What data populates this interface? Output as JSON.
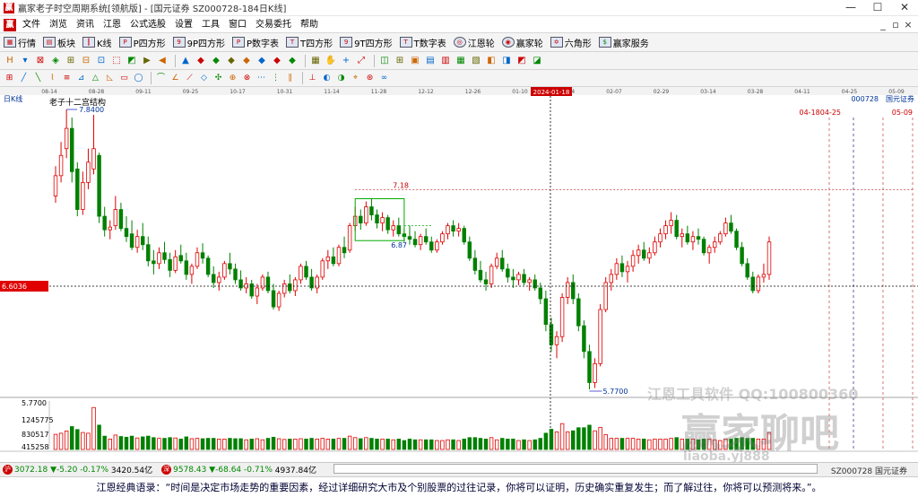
{
  "window": {
    "title": "赢家老子时空周期系统[领航版] - [国元证券 SZ000728-184日K线]",
    "controls": [
      "—",
      "☐",
      "✕"
    ]
  },
  "menu": {
    "items": [
      "文件",
      "浏览",
      "资讯",
      "江恩",
      "公式选股",
      "设置",
      "工具",
      "窗口",
      "交易委托",
      "帮助"
    ],
    "mdi_controls": [
      "_",
      "▫",
      "×"
    ]
  },
  "toolbar1": {
    "items": [
      "行情",
      "板块",
      "K线",
      "P四方形",
      "9P四方形",
      "P数字表",
      "T四方形",
      "9T四方形",
      "T数字表",
      "江恩轮",
      "赢家轮",
      "六角形",
      "赢家服务"
    ]
  },
  "chart": {
    "panel_label": "日K线",
    "indicator_name": "老子十二宫结构",
    "stock_code": "000728",
    "stock_name": "国元证券",
    "cursor_date": "2024-01-18",
    "top_dates": [
      "08-14",
      "08-28",
      "09-11",
      "09-25",
      "10-17",
      "10-31",
      "11-14",
      "11-28",
      "12-12",
      "12-26",
      "01-10",
      "01-24",
      "02-07",
      "02-29",
      "03-14",
      "03-28",
      "04-11",
      "04-25",
      "05-09"
    ],
    "future_dates": [
      "04-18",
      "04-25",
      "05-09"
    ],
    "price_labels": {
      "high": "7.8400",
      "level_718": "7.18",
      "level_687": "6.87",
      "low": "5.7700",
      "cursor_price": "6.6036"
    },
    "volume_labels": [
      "5.7700",
      "1245775",
      "830517",
      "415258"
    ],
    "watermark": {
      "line1": "江恩工具软件  QQ:100800360",
      "line2": "赢家聊吧",
      "line3": "liaoba.yj888"
    },
    "colors": {
      "up": "#e00000",
      "down": "#008000",
      "cursor": "#e00000",
      "date_blue": "#003399"
    }
  },
  "chart_data": {
    "type": "candlestick",
    "title": "国元证券 SZ000728-184日K线",
    "indicator": "老子十二宫结构",
    "ohlc_note": "approximate, read from chart",
    "ohlc": [
      [
        7.2,
        7.42,
        7.15,
        7.35
      ],
      [
        7.35,
        7.6,
        7.3,
        7.5
      ],
      [
        7.55,
        7.84,
        7.48,
        7.7
      ],
      [
        7.7,
        7.78,
        7.3,
        7.38
      ],
      [
        7.4,
        7.45,
        7.05,
        7.1
      ],
      [
        7.1,
        7.38,
        7.06,
        7.3
      ],
      [
        7.3,
        7.55,
        7.25,
        7.45
      ],
      [
        7.4,
        7.8,
        7.36,
        7.55
      ],
      [
        7.5,
        7.52,
        7.0,
        7.05
      ],
      [
        7.05,
        7.12,
        6.9,
        6.95
      ],
      [
        6.95,
        7.02,
        6.88,
        6.97
      ],
      [
        6.98,
        7.2,
        6.95,
        7.1
      ],
      [
        7.1,
        7.15,
        6.94,
        6.96
      ],
      [
        6.96,
        7.05,
        6.86,
        6.9
      ],
      [
        6.92,
        7.02,
        6.8,
        6.82
      ],
      [
        6.82,
        6.95,
        6.78,
        6.9
      ],
      [
        6.9,
        7.0,
        6.8,
        6.84
      ],
      [
        6.84,
        6.9,
        6.68,
        6.72
      ],
      [
        6.72,
        6.8,
        6.62,
        6.7
      ],
      [
        6.7,
        6.82,
        6.66,
        6.78
      ],
      [
        6.78,
        6.86,
        6.7,
        6.73
      ],
      [
        6.73,
        6.78,
        6.6,
        6.65
      ],
      [
        6.65,
        6.8,
        6.63,
        6.75
      ],
      [
        6.76,
        6.84,
        6.7,
        6.72
      ],
      [
        6.72,
        6.78,
        6.58,
        6.62
      ],
      [
        6.62,
        6.7,
        6.55,
        6.68
      ],
      [
        6.68,
        6.82,
        6.66,
        6.78
      ],
      [
        6.78,
        6.85,
        6.7,
        6.74
      ],
      [
        6.74,
        6.76,
        6.6,
        6.62
      ],
      [
        6.62,
        6.68,
        6.52,
        6.56
      ],
      [
        6.56,
        6.64,
        6.5,
        6.6
      ],
      [
        6.6,
        6.72,
        6.58,
        6.7
      ],
      [
        6.7,
        6.78,
        6.62,
        6.66
      ],
      [
        6.66,
        6.7,
        6.55,
        6.58
      ],
      [
        6.58,
        6.65,
        6.5,
        6.52
      ],
      [
        6.52,
        6.6,
        6.48,
        6.55
      ],
      [
        6.55,
        6.58,
        6.44,
        6.46
      ],
      [
        6.46,
        6.55,
        6.4,
        6.52
      ],
      [
        6.52,
        6.62,
        6.5,
        6.6
      ],
      [
        6.6,
        6.64,
        6.48,
        6.5
      ],
      [
        6.5,
        6.55,
        6.36,
        6.38
      ],
      [
        6.38,
        6.5,
        6.35,
        6.48
      ],
      [
        6.48,
        6.58,
        6.45,
        6.55
      ],
      [
        6.55,
        6.62,
        6.48,
        6.5
      ],
      [
        6.5,
        6.6,
        6.46,
        6.58
      ],
      [
        6.58,
        6.7,
        6.55,
        6.68
      ],
      [
        6.68,
        6.72,
        6.58,
        6.6
      ],
      [
        6.6,
        6.66,
        6.5,
        6.52
      ],
      [
        6.52,
        6.62,
        6.48,
        6.6
      ],
      [
        6.6,
        6.74,
        6.58,
        6.72
      ],
      [
        6.72,
        6.8,
        6.66,
        6.75
      ],
      [
        6.75,
        6.82,
        6.68,
        6.7
      ],
      [
        6.7,
        6.84,
        6.68,
        6.82
      ],
      [
        6.82,
        6.9,
        6.74,
        6.78
      ],
      [
        6.8,
        7.0,
        6.78,
        6.98
      ],
      [
        6.98,
        7.12,
        6.94,
        7.05
      ],
      [
        7.05,
        7.1,
        6.95,
        7.0
      ],
      [
        7.0,
        7.16,
        6.98,
        7.12
      ],
      [
        7.12,
        7.18,
        7.02,
        7.06
      ],
      [
        7.06,
        7.1,
        6.96,
        7.0
      ],
      [
        7.0,
        7.08,
        6.94,
        7.04
      ],
      [
        7.04,
        7.06,
        6.92,
        6.95
      ],
      [
        6.95,
        7.02,
        6.9,
        6.98
      ],
      [
        6.98,
        7.04,
        6.9,
        6.92
      ],
      [
        6.92,
        6.96,
        6.86,
        6.9
      ],
      [
        6.9,
        6.98,
        6.84,
        6.88
      ],
      [
        6.88,
        6.94,
        6.82,
        6.84
      ],
      [
        6.84,
        6.92,
        6.8,
        6.9
      ],
      [
        6.9,
        6.96,
        6.84,
        6.86
      ],
      [
        6.86,
        6.9,
        6.78,
        6.8
      ],
      [
        6.8,
        6.88,
        6.78,
        6.86
      ],
      [
        6.86,
        6.94,
        6.84,
        6.92
      ],
      [
        6.92,
        7.0,
        6.88,
        6.98
      ],
      [
        6.98,
        7.02,
        6.9,
        6.94
      ],
      [
        6.94,
        7.0,
        6.9,
        6.96
      ],
      [
        6.96,
        6.98,
        6.84,
        6.86
      ],
      [
        6.86,
        6.9,
        6.72,
        6.74
      ],
      [
        6.74,
        6.8,
        6.62,
        6.65
      ],
      [
        6.65,
        6.72,
        6.56,
        6.58
      ],
      [
        6.58,
        6.64,
        6.5,
        6.55
      ],
      [
        6.55,
        6.7,
        6.52,
        6.68
      ],
      [
        6.68,
        6.78,
        6.66,
        6.74
      ],
      [
        6.74,
        6.8,
        6.64,
        6.66
      ],
      [
        6.66,
        6.7,
        6.56,
        6.6
      ],
      [
        6.6,
        6.66,
        6.52,
        6.58
      ],
      [
        6.58,
        6.64,
        6.54,
        6.62
      ],
      [
        6.62,
        6.66,
        6.54,
        6.56
      ],
      [
        6.56,
        6.6,
        6.5,
        6.58
      ],
      [
        6.58,
        6.62,
        6.5,
        6.52
      ],
      [
        6.52,
        6.56,
        6.4,
        6.44
      ],
      [
        6.44,
        6.5,
        6.2,
        6.25
      ],
      [
        6.25,
        6.3,
        6.05,
        6.1
      ],
      [
        6.1,
        6.2,
        6.0,
        6.16
      ],
      [
        6.16,
        6.48,
        6.12,
        6.45
      ],
      [
        6.45,
        6.6,
        6.4,
        6.56
      ],
      [
        6.56,
        6.62,
        6.4,
        6.44
      ],
      [
        6.44,
        6.48,
        6.2,
        6.24
      ],
      [
        6.24,
        6.28,
        6.0,
        6.05
      ],
      [
        6.05,
        6.1,
        5.77,
        5.82
      ],
      [
        5.82,
        6.0,
        5.78,
        5.96
      ],
      [
        5.96,
        6.4,
        5.94,
        6.36
      ],
      [
        6.36,
        6.6,
        6.34,
        6.56
      ],
      [
        6.56,
        6.66,
        6.5,
        6.62
      ],
      [
        6.62,
        6.74,
        6.58,
        6.7
      ],
      [
        6.7,
        6.76,
        6.6,
        6.64
      ],
      [
        6.64,
        6.72,
        6.56,
        6.68
      ],
      [
        6.68,
        6.8,
        6.64,
        6.76
      ],
      [
        6.76,
        6.84,
        6.7,
        6.8
      ],
      [
        6.8,
        6.86,
        6.72,
        6.74
      ],
      [
        6.74,
        6.82,
        6.7,
        6.78
      ],
      [
        6.78,
        6.9,
        6.76,
        6.86
      ],
      [
        6.86,
        6.96,
        6.82,
        6.92
      ],
      [
        6.92,
        7.02,
        6.88,
        6.98
      ],
      [
        6.98,
        7.08,
        6.92,
        7.02
      ],
      [
        7.02,
        7.06,
        6.88,
        6.9
      ],
      [
        6.9,
        6.96,
        6.82,
        6.92
      ],
      [
        6.92,
        6.98,
        6.84,
        6.86
      ],
      [
        6.86,
        6.94,
        6.8,
        6.9
      ],
      [
        6.9,
        6.96,
        6.84,
        6.88
      ],
      [
        6.88,
        6.9,
        6.76,
        6.78
      ],
      [
        6.78,
        6.84,
        6.7,
        6.82
      ],
      [
        6.82,
        6.9,
        6.78,
        6.86
      ],
      [
        6.86,
        6.94,
        6.84,
        6.92
      ],
      [
        6.92,
        7.04,
        6.9,
        7.0
      ],
      [
        7.0,
        7.06,
        6.92,
        6.94
      ],
      [
        6.94,
        6.96,
        6.8,
        6.82
      ],
      [
        6.82,
        6.86,
        6.68,
        6.7
      ],
      [
        6.7,
        6.74,
        6.58,
        6.6
      ],
      [
        6.6,
        6.64,
        6.48,
        6.5
      ],
      [
        6.5,
        6.62,
        6.48,
        6.6
      ],
      [
        6.6,
        6.7,
        6.56,
        6.62
      ],
      [
        6.62,
        6.9,
        6.58,
        6.86
      ]
    ],
    "volume_ticks": [
      415258,
      830517,
      1245775
    ],
    "ylim": [
      5.77,
      7.84
    ],
    "x_ticks": [
      "08-14",
      "08-28",
      "09-11",
      "09-25",
      "10-17",
      "10-31",
      "11-14",
      "11-28",
      "12-12",
      "12-26",
      "01-10",
      "01-24",
      "02-07",
      "02-29",
      "03-14",
      "03-28",
      "04-11",
      "04-25",
      "05-09"
    ]
  },
  "status": {
    "sh_badge": "沪",
    "sh_value": "3072.18",
    "sh_change": "▼-5.20",
    "sh_pct": "-0.17%",
    "sh_amount": "3420.54亿",
    "sz_badge": "深",
    "sz_value": "9578.43",
    "sz_change": "▼-68.64",
    "sz_pct": "-0.71%",
    "sz_amount": "4937.84亿",
    "code": "SZ000728 国元证券"
  },
  "quote": "江恩经典语录：“时间是决定市场走势的重要因素，经过详细研究大市及个别股票的过往记录，你将可以证明，历史确实重复发生；而了解过往，你将可以预测将来。”。"
}
